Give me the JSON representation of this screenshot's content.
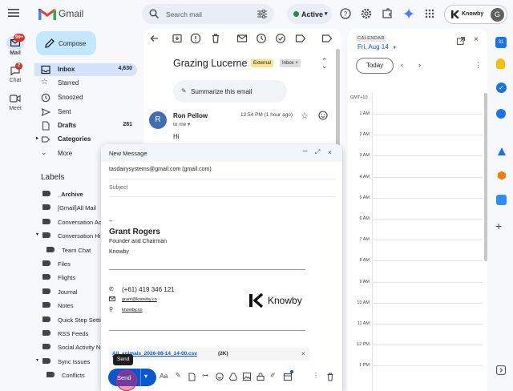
{
  "app": {
    "name": "Gmail"
  },
  "search": {
    "placeholder": "Search mail"
  },
  "status": {
    "label": "Active"
  },
  "brand": {
    "label": "Knowby",
    "avatar": "G"
  },
  "rail": {
    "mail": {
      "label": "Mail",
      "badge": "99+"
    },
    "chat": {
      "label": "Chat",
      "badge": "2"
    },
    "meet": {
      "label": "Meet"
    }
  },
  "compose_button": "Compose",
  "nav": [
    {
      "label": "Inbox",
      "count": "4,630",
      "icon": "inbox-icon"
    },
    {
      "label": "Starred",
      "count": "",
      "icon": "star-icon"
    },
    {
      "label": "Snoozed",
      "count": "",
      "icon": "clock-icon"
    },
    {
      "label": "Sent",
      "count": "",
      "icon": "send-icon"
    },
    {
      "label": "Drafts",
      "count": "281",
      "icon": "draft-icon"
    },
    {
      "label": "Categories",
      "count": "",
      "icon": "label-icon"
    },
    {
      "label": "More",
      "count": "",
      "icon": "chevron-down-icon"
    }
  ],
  "labels_heading": "Labels",
  "labels": [
    "_Archive",
    "[Gmail]All Mail",
    "Conversation Ac",
    "Conversation Hi",
    "Team Chat",
    "Files",
    "Flights",
    "Journal",
    "Notes",
    "Quick Step Setti",
    "RSS Feeds",
    "Social Activity N",
    "Sync Issues",
    "Conflicts"
  ],
  "email": {
    "subject": "Grazing Lucerne",
    "badge_external": "External",
    "badge_inbox": "Inbox ×",
    "summarize": "Summarize this email",
    "sender": "Ron Pellow",
    "sender_initial": "R",
    "to": "to me ▾",
    "time": "12:54 PM (1 hour ago)",
    "body": "Hi"
  },
  "compose": {
    "title": "New Message",
    "to": "tasdairysystems@gmail.com (gmail.com)",
    "subject_placeholder": "Subject",
    "sig_dash": "--",
    "sig_name": "Grant Rogers",
    "sig_role": "Founder and Chairman",
    "sig_company": "Knowby",
    "phone": "(+61) 419 346 121",
    "email": "grant@knowby.co",
    "web": "knowby.co",
    "logo_text": "Knowby",
    "attachment": "All_animals_2026-08-14_14-00.csv",
    "attachment_size": "(2K)",
    "send": "Send",
    "tooltip": "Send"
  },
  "calendar": {
    "heading": "CALENDAR",
    "date": "Fri, Aug 14",
    "today": "Today",
    "tz": "GMT+10",
    "hours": [
      "1 AM",
      "2 AM",
      "3 AM",
      "4 AM",
      "5 AM",
      "6 AM",
      "7 AM",
      "8 AM",
      "9 AM",
      "10 AM",
      "11 AM",
      "12 PM",
      "1 PM"
    ]
  },
  "colors": {
    "accent": "#0b57d0",
    "compose": "#c2e7ff",
    "inbox_active": "#d3e3fd",
    "active_dot": "#1e8e3e"
  }
}
